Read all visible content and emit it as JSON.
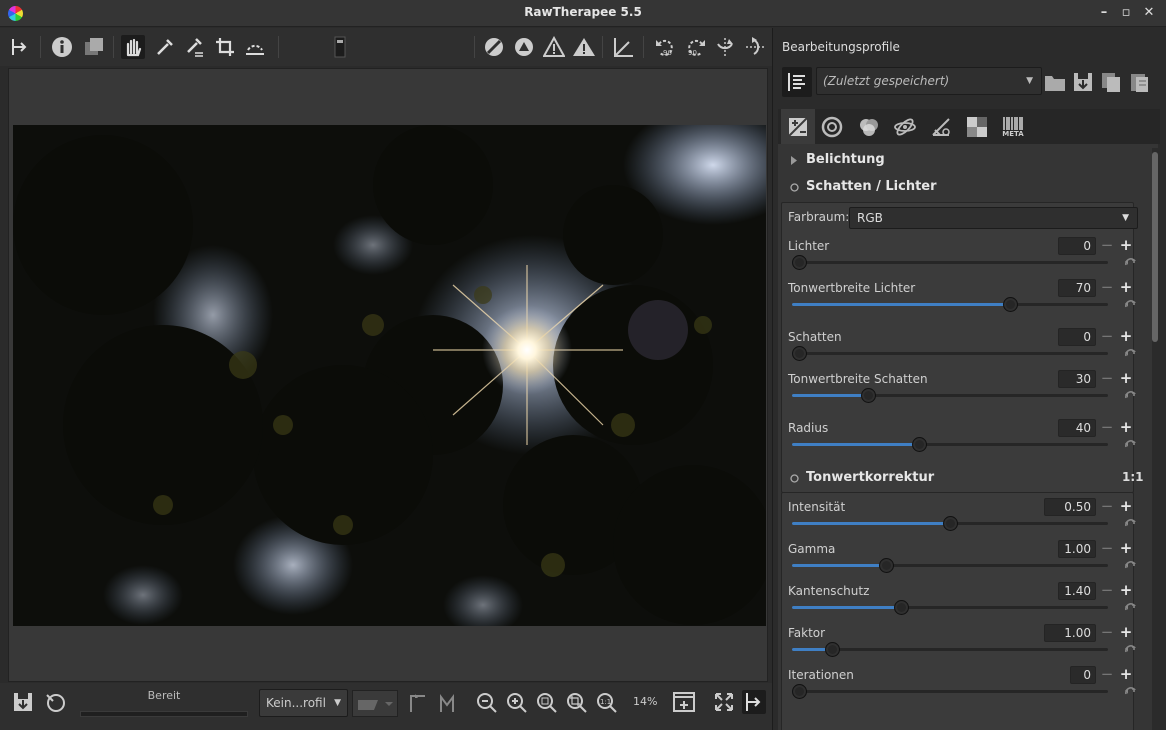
{
  "window": {
    "title": "RawTherapee 5.5"
  },
  "icons": {
    "toolbar": [
      "panel-toggle-icon",
      "info-icon",
      "before-after-icon",
      "hand-icon",
      "color-picker-icon",
      "white-balance-picker-icon",
      "crop-icon",
      "straighten-icon"
    ],
    "tabs": [
      "exposure-tab-icon",
      "detail-tab-icon",
      "color-tab-icon",
      "advanced-tab-icon",
      "transform-tab-icon",
      "raw-tab-icon",
      "metadata-tab-icon"
    ]
  },
  "status": {
    "text": "Bereit",
    "progress": 0
  },
  "bottom": {
    "profile_combo": "Kein...rofil",
    "zoom": "14%"
  },
  "right_panel": {
    "header": "Bearbeitungsprofile",
    "profile_value": "(Zuletzt gespeichert)",
    "meta_tab": "META"
  },
  "sections": {
    "belichtung": {
      "title": "Belichtung"
    },
    "schatten": {
      "title": "Schatten / Lichter",
      "farbraum_label": "Farbraum:",
      "farbraum_value": "RGB",
      "sliders": [
        {
          "label": "Lichter",
          "value": "0",
          "fraction": 0.0
        },
        {
          "label": "Tonwertbreite Lichter",
          "value": "70",
          "fraction": 0.7
        },
        {
          "label": "Schatten",
          "value": "0",
          "fraction": 0.0
        },
        {
          "label": "Tonwertbreite Schatten",
          "value": "30",
          "fraction": 0.23
        },
        {
          "label": "Radius",
          "value": "40",
          "fraction": 0.4
        }
      ]
    },
    "tonwert": {
      "title": "Tonwertkorrektur",
      "badge": "1:1",
      "sliders": [
        {
          "label": "Intensität",
          "value": "0.50",
          "fraction": 0.5
        },
        {
          "label": "Gamma",
          "value": "1.00",
          "fraction": 0.29
        },
        {
          "label": "Kantenschutz",
          "value": "1.40",
          "fraction": 0.34
        },
        {
          "label": "Faktor",
          "value": "1.00",
          "fraction": 0.11
        },
        {
          "label": "Iterationen",
          "value": "0",
          "fraction": 0.0
        }
      ]
    }
  },
  "colors": {
    "accent": "#3f7fc4",
    "panel": "#353535",
    "group": "#3b3b3b"
  }
}
